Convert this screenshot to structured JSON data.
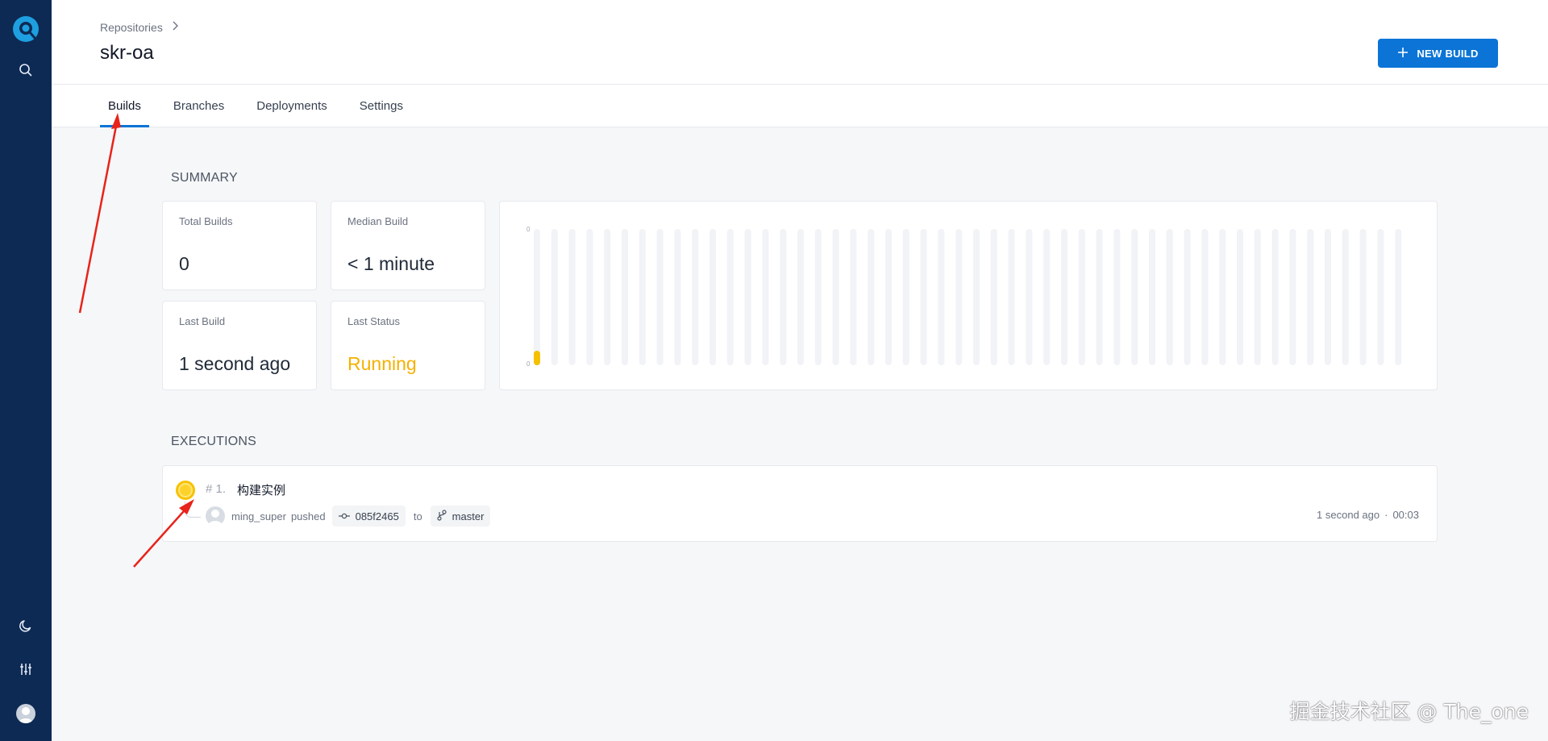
{
  "header": {
    "breadcrumb": "Repositories",
    "title": "skr-oa",
    "new_build_label": "NEW BUILD"
  },
  "tabs": [
    {
      "label": "Builds",
      "active": true
    },
    {
      "label": "Branches",
      "active": false
    },
    {
      "label": "Deployments",
      "active": false
    },
    {
      "label": "Settings",
      "active": false
    }
  ],
  "summary": {
    "section_label": "SUMMARY",
    "total_builds": {
      "label": "Total Builds",
      "value": "0"
    },
    "median_build": {
      "label": "Median Build",
      "value": "< 1 minute"
    },
    "last_build": {
      "label": "Last Build",
      "value": "1 second ago"
    },
    "last_status": {
      "label": "Last Status",
      "value": "Running"
    }
  },
  "chart_data": {
    "type": "bar",
    "bar_count": 50,
    "values": [
      0,
      0,
      0,
      0,
      0,
      0,
      0,
      0,
      0,
      0,
      0,
      0,
      0,
      0,
      0,
      0,
      0,
      0,
      0,
      0,
      0,
      0,
      0,
      0,
      0,
      0,
      0,
      0,
      0,
      0,
      0,
      0,
      0,
      0,
      0,
      0,
      0,
      0,
      0,
      0,
      0,
      0,
      0,
      0,
      0,
      0,
      0,
      0,
      0,
      0
    ],
    "running_index": 0,
    "ytick_top": "0",
    "ytick_bottom": "0",
    "colors": {
      "track": "#f1f3f6",
      "running": "#f5c000"
    }
  },
  "executions": {
    "section_label": "EXECUTIONS",
    "items": [
      {
        "number": "# 1.",
        "title": "构建实例",
        "author": "ming_super",
        "action": "pushed",
        "commit": "085f2465",
        "to_text": "to",
        "branch": "master",
        "when": "1 second ago",
        "separator": "·",
        "duration": "00:03",
        "status": "running"
      }
    ]
  },
  "watermark": "掘金技术社区 @ The_one",
  "colors": {
    "sidebar": "#0d2a54",
    "accent": "#0b74d6",
    "running": "#f5b100",
    "annotation_arrow": "#e8231a"
  }
}
